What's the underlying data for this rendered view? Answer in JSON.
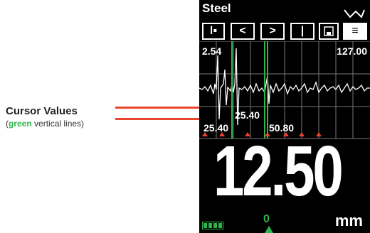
{
  "annotation": {
    "title": "Cursor Values",
    "sub_open": "(",
    "sub_green": "green",
    "sub_rest": " vertical lines)",
    "leader_color": "#e8452c",
    "accent_green": "#2fb34a"
  },
  "device": {
    "material": "Steel",
    "toolbar": [
      {
        "name": "gate-icon",
        "glyph": "⫼"
      },
      {
        "name": "prev-button",
        "glyph": "<"
      },
      {
        "name": "next-button",
        "glyph": ">"
      },
      {
        "name": "cursor-icon",
        "glyph": "|"
      },
      {
        "name": "save-icon",
        "glyph": "▣"
      },
      {
        "name": "menu-icon",
        "glyph": "≡"
      }
    ],
    "waveform": {
      "range_start": "2.54",
      "range_end": "127.00",
      "cursor_value_1": "25.40",
      "cursor_value_2": "25.40",
      "cursor_value_3": "50.80"
    },
    "reading": "12.50",
    "unit": "mm",
    "probe_label": "0"
  }
}
